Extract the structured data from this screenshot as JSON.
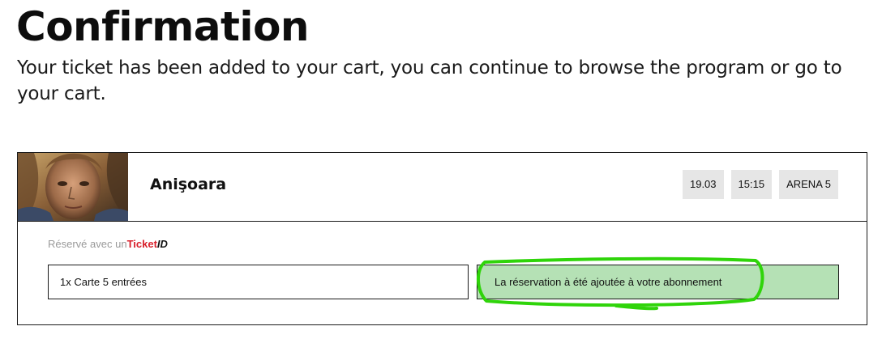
{
  "page": {
    "title": "Confirmation",
    "intro": "Your ticket has been added to your cart, you can continue to browse the program or go to your cart."
  },
  "booking": {
    "film_title": "Anişoara",
    "poster_icon": "film-poster-image",
    "tags": {
      "date": "19.03",
      "time": "15:15",
      "venue": "ARENA 5"
    },
    "reserved_prefix": "Réservé avec un",
    "brand_ticket": "Ticket",
    "brand_id": "ID",
    "ticket_item": "1x Carte 5 entrées",
    "status_message": "La réservation à été ajoutée à votre abonnement"
  },
  "colors": {
    "status_bg": "#b5e1b5",
    "tag_bg": "#e6e6e6",
    "brand_red": "#d8202c",
    "annotation_green": "#2fd40a"
  }
}
